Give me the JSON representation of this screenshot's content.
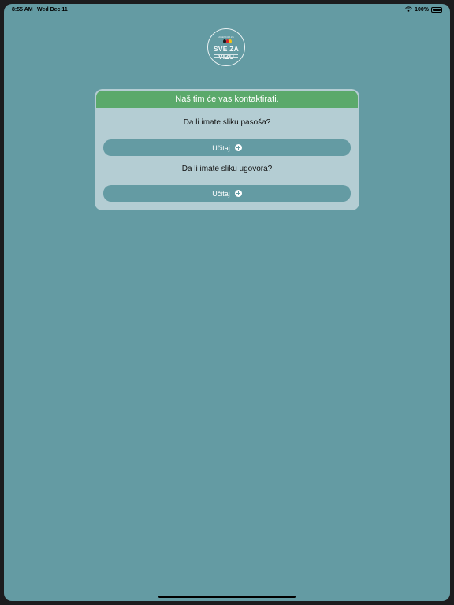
{
  "status_bar": {
    "time": "8:55 AM",
    "date": "Wed Dec 11",
    "battery_text": "100%",
    "battery_level": 1.0
  },
  "logo": {
    "brand_text": "SVE ZA VIZU",
    "small_text": "AGENCIJA ZA"
  },
  "card": {
    "header": "Naš tim će vas kontaktirati.",
    "passport_question": "Da li imate sliku pasoša?",
    "passport_button": "Učitaj",
    "contract_question": "Da li imate sliku ugovora?",
    "contract_button": "Učitaj"
  },
  "colors": {
    "background": "#649ba3",
    "card": "#b4cdd3",
    "header": "#5ba96b",
    "button": "#649ba3"
  },
  "icons": [
    "wifi-icon",
    "battery-icon",
    "plus-circle-icon",
    "logo-flag-icon"
  ]
}
